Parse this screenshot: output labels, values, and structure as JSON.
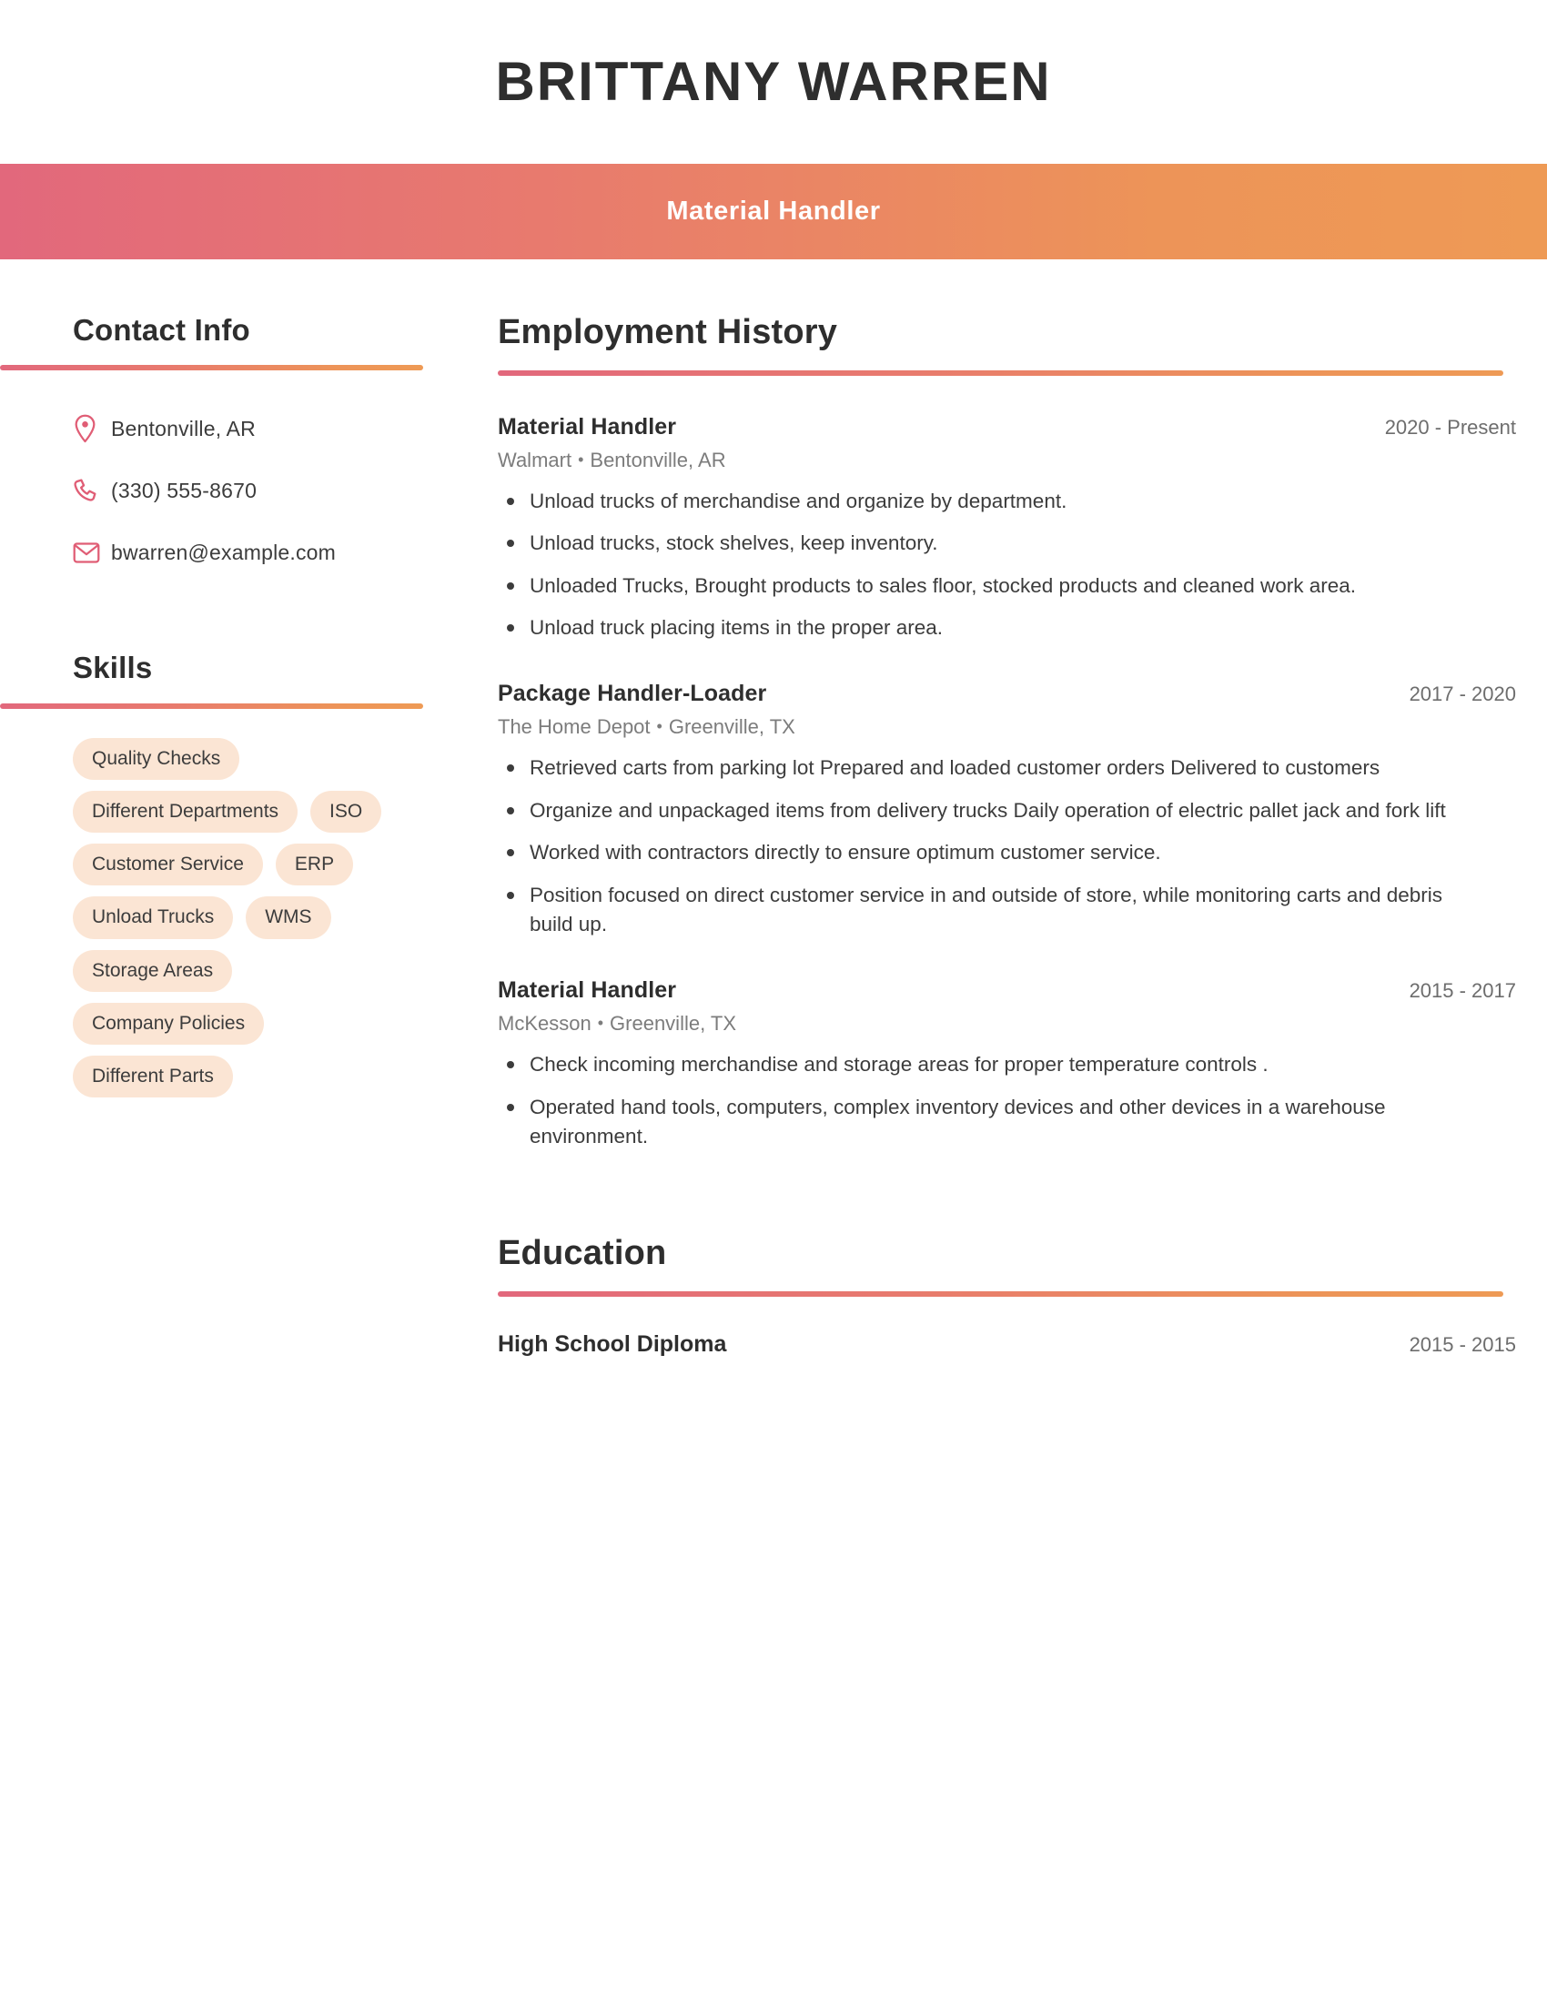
{
  "header": {
    "name": "BRITTANY WARREN",
    "title": "Material Handler",
    "gradient_start": "#e2687c",
    "gradient_end": "#ee9a55"
  },
  "sidebar": {
    "contact": {
      "heading": "Contact Info",
      "items": [
        {
          "icon": "map-pin-icon",
          "text": "Bentonville, AR"
        },
        {
          "icon": "phone-icon",
          "text": "(330) 555-8670"
        },
        {
          "icon": "envelope-icon",
          "text": "bwarren@example.com"
        }
      ]
    },
    "skills": {
      "heading": "Skills",
      "items": [
        "Quality Checks",
        "Different Departments",
        "ISO",
        "Customer Service",
        "ERP",
        "Unload Trucks",
        "WMS",
        "Storage Areas",
        "Company Policies",
        "Different Parts"
      ],
      "pill_color": "#fbe5d4"
    }
  },
  "main": {
    "employment": {
      "heading": "Employment History",
      "jobs": [
        {
          "title": "Material Handler",
          "dates": "2020 - Present",
          "company": "Walmart",
          "location": "Bentonville, AR",
          "bullets": [
            "Unload trucks of merchandise and organize by department.",
            "Unload trucks, stock shelves, keep inventory.",
            "Unloaded Trucks, Brought products to sales floor, stocked products and cleaned work area.",
            "Unload truck placing items in the proper area."
          ]
        },
        {
          "title": "Package Handler-Loader",
          "dates": "2017 - 2020",
          "company": "The Home Depot",
          "location": "Greenville, TX",
          "bullets": [
            "Retrieved carts from parking lot Prepared and loaded customer orders Delivered to customers",
            "Organize and unpackaged items from delivery trucks Daily operation of electric pallet jack and fork lift",
            "Worked with contractors directly to ensure optimum customer service.",
            "Position focused on direct customer service in and outside of store, while monitoring carts and debris build up."
          ]
        },
        {
          "title": "Material Handler",
          "dates": "2015 - 2017",
          "company": "McKesson",
          "location": "Greenville, TX",
          "bullets": [
            "Check incoming merchandise and storage areas for proper temperature controls .",
            "Operated hand tools, computers, complex inventory devices and other devices in a warehouse environment."
          ]
        }
      ]
    },
    "education": {
      "heading": "Education",
      "entries": [
        {
          "degree": "High School Diploma",
          "dates": "2015 - 2015"
        }
      ]
    }
  },
  "separator": "•"
}
